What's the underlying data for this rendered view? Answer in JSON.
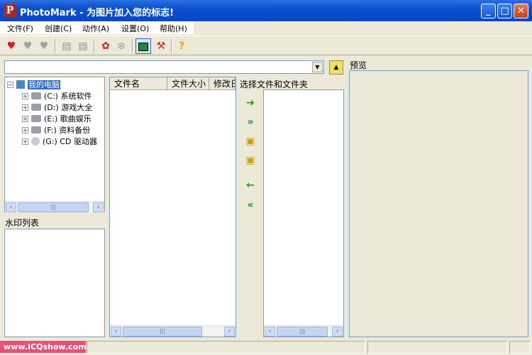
{
  "window": {
    "title": "PhotoMark - 为图片加入您的标志!",
    "app_icon_text": "P"
  },
  "menu": {
    "items": [
      {
        "label": "文件(F)"
      },
      {
        "label": "创建(C)"
      },
      {
        "label": "动作(A)"
      },
      {
        "label": "设置(O)"
      },
      {
        "label": "帮助(H)"
      }
    ]
  },
  "toolbar": {
    "icons": [
      "heart-icon",
      "heart-add-icon",
      "heart-remove-icon",
      "document-icon",
      "documents-icon",
      "refresh-icon",
      "stop-icon",
      "image-icon",
      "tools-icon",
      "help-icon"
    ]
  },
  "path_combo": {
    "value": ""
  },
  "tree": {
    "root": "我的电脑",
    "drives": [
      {
        "label": "(C:) 系统软件"
      },
      {
        "label": "(D:) 游戏大全"
      },
      {
        "label": "(E:) 歌曲娱乐"
      },
      {
        "label": "(F:) 资料备份"
      },
      {
        "label": "(G:) CD 驱动器"
      }
    ]
  },
  "watermark_list": {
    "title": "水印列表"
  },
  "file_list": {
    "columns": [
      "文件名",
      "文件大小",
      "修改日"
    ]
  },
  "selection": {
    "title": "选择文件和文件夹"
  },
  "preview": {
    "title": "预览"
  },
  "statusbar": {
    "watermark_text": "www.ICQshow.com"
  }
}
